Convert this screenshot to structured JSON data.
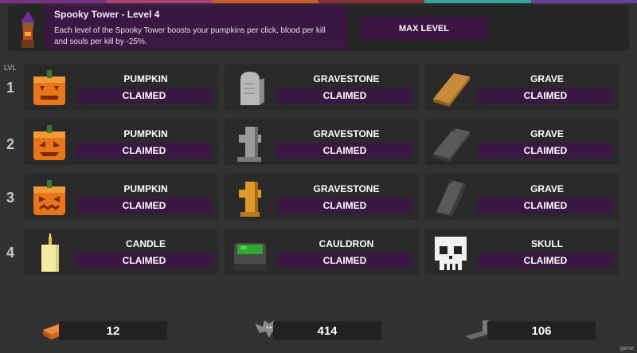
{
  "colors": {
    "top_strip": [
      "#7a2f8a",
      "#b43c7a",
      "#d05a2c",
      "#8a2f3a",
      "#2fa8a0",
      "#6b3fa0"
    ]
  },
  "header": {
    "title": "Spooky Tower - Level 4",
    "description": "Each level of the Spooky Tower boosts your pumpkins per click, blood per kill and souls per kill by -25%.",
    "button_label": "MAX LEVEL",
    "icon": "tower-icon"
  },
  "lvl_label": "LVL",
  "rows": [
    {
      "level": "1",
      "cells": [
        {
          "name": "PUMPKIN",
          "status": "CLAIMED",
          "icon": "pumpkin-icon"
        },
        {
          "name": "GRAVESTONE",
          "status": "CLAIMED",
          "icon": "gravestone-icon"
        },
        {
          "name": "GRAVE",
          "status": "CLAIMED",
          "icon": "grave-icon"
        }
      ]
    },
    {
      "level": "2",
      "cells": [
        {
          "name": "PUMPKIN",
          "status": "CLAIMED",
          "icon": "pumpkin-icon"
        },
        {
          "name": "GRAVESTONE",
          "status": "CLAIMED",
          "icon": "gravestone-icon"
        },
        {
          "name": "GRAVE",
          "status": "CLAIMED",
          "icon": "grave-icon"
        }
      ]
    },
    {
      "level": "3",
      "cells": [
        {
          "name": "PUMPKIN",
          "status": "CLAIMED",
          "icon": "pumpkin-icon"
        },
        {
          "name": "GRAVESTONE",
          "status": "CLAIMED",
          "icon": "gravestone-icon"
        },
        {
          "name": "GRAVE",
          "status": "CLAIMED",
          "icon": "grave-icon"
        }
      ]
    },
    {
      "level": "4",
      "cells": [
        {
          "name": "CANDLE",
          "status": "CLAIMED",
          "icon": "candle-icon"
        },
        {
          "name": "CAULDRON",
          "status": "CLAIMED",
          "icon": "cauldron-icon"
        },
        {
          "name": "SKULL",
          "status": "CLAIMED",
          "icon": "skull-icon"
        }
      ]
    }
  ],
  "resources": [
    {
      "value": "12",
      "icon": "brick-icon"
    },
    {
      "value": "414",
      "icon": "bat-icon"
    },
    {
      "value": "106",
      "icon": "tombstone-icon"
    }
  ],
  "watermark": "game"
}
